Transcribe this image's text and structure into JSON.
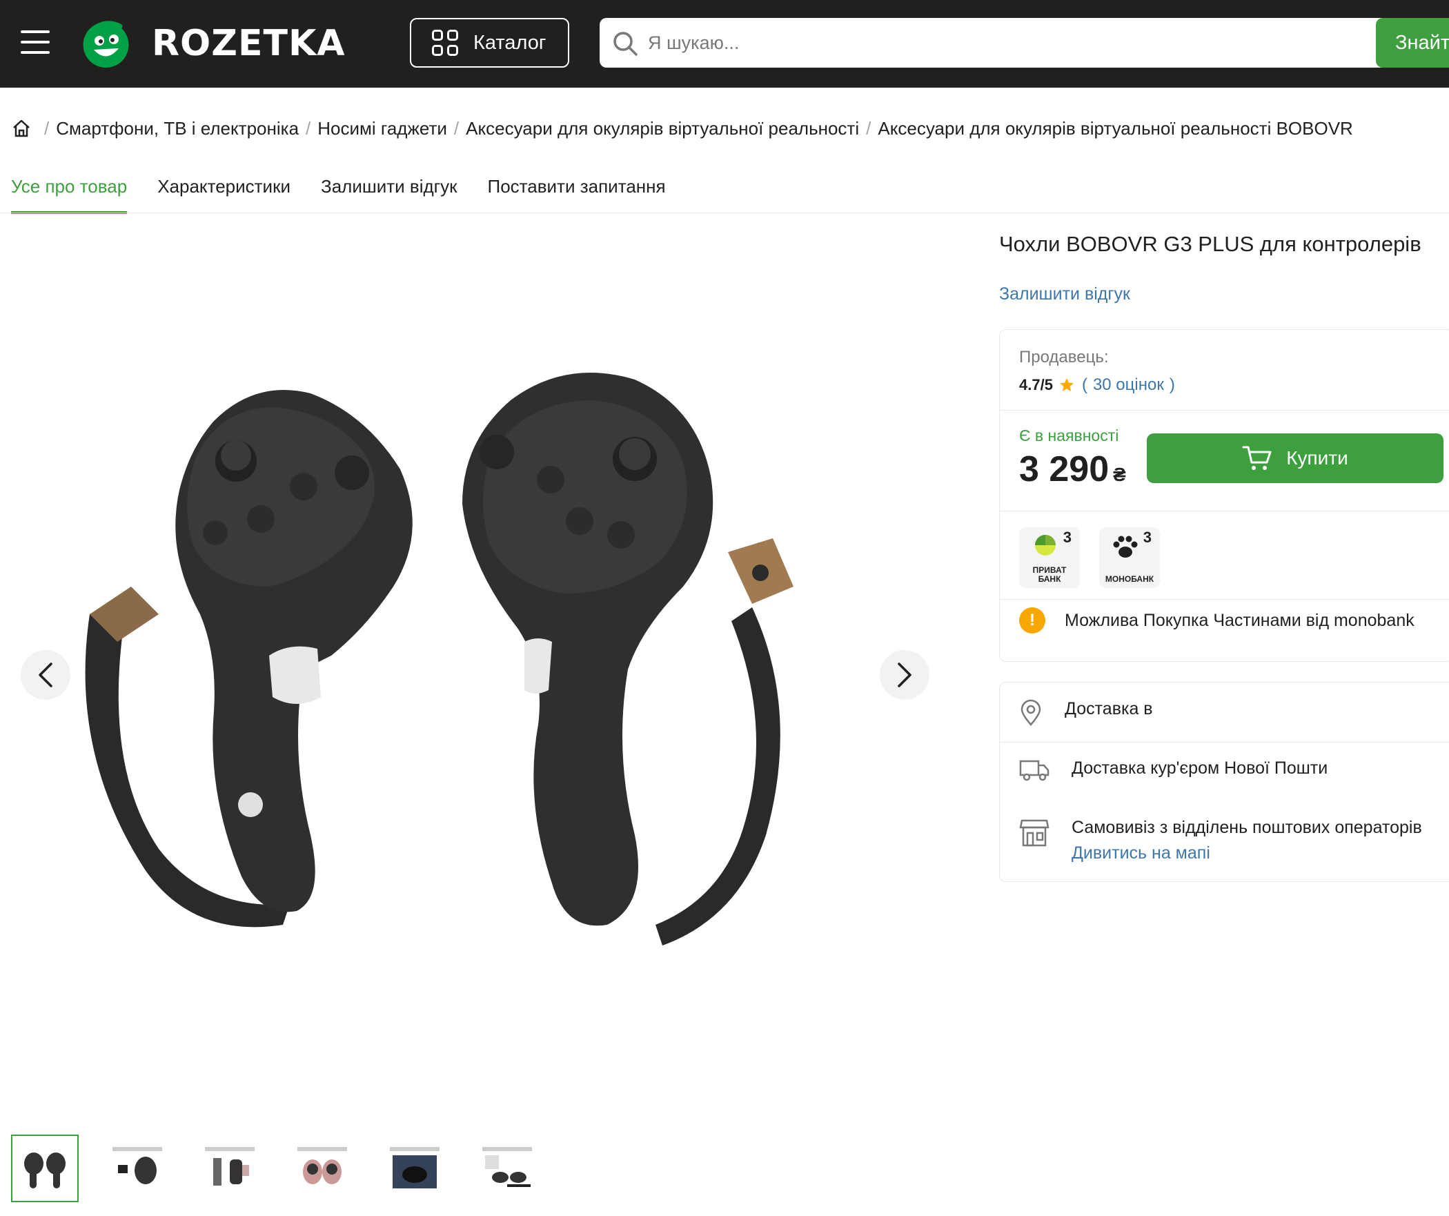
{
  "header": {
    "logo_text": "ROZETKA",
    "catalog_label": "Каталог",
    "search_placeholder": "Я шукаю...",
    "search_button": "Знайти"
  },
  "breadcrumb": [
    "Смартфони, ТВ і електроніка",
    "Носимі гаджети",
    "Аксесуари для окулярів віртуальної реальності",
    "Аксесуари для окулярів віртуальної реальності BOBOVR"
  ],
  "tabs": [
    "Усе про товар",
    "Характеристики",
    "Залишити відгук",
    "Поставити запитання"
  ],
  "product": {
    "title": "Чохли BOBOVR G3 PLUS для контролерів",
    "review_link": "Залишити відгук",
    "seller_label": "Продавець:",
    "seller_rating": "4.7/5",
    "seller_reviews_open": "(",
    "seller_reviews": "30 оцінок",
    "seller_reviews_close": ")",
    "availability": "Є в наявності",
    "price": "3 290",
    "currency": "₴",
    "buy_label": "Купити",
    "banks": [
      {
        "name_line1": "ПРИВАТ",
        "name_line2": "БАНК",
        "badge": "3"
      },
      {
        "name_line1": "МОНОБАНК",
        "name_line2": "",
        "badge": "3"
      }
    ],
    "installment_text": "Можлива Покупка Частинами від monobank"
  },
  "delivery": {
    "location_label": "Доставка в",
    "courier": "Доставка кур'єром Нової Пошти",
    "pickup": "Самовивіз з відділень поштових операторів",
    "map_link": "Дивитись на мапі"
  },
  "colors": {
    "header_bg": "#221f1f",
    "accent_green": "#3e9f3e",
    "link_blue": "#3e77aa",
    "warning_orange": "#f8a700"
  }
}
